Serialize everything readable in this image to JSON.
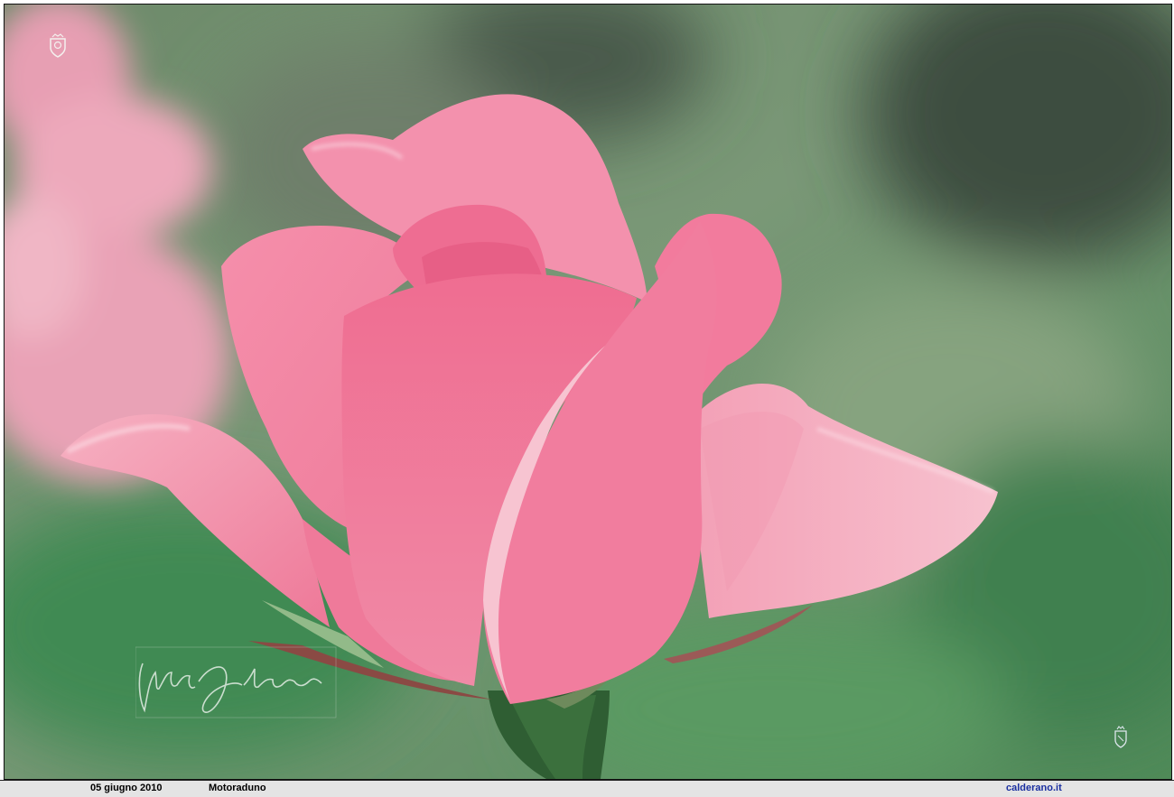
{
  "photo": {
    "subject": "pink-rose-bud",
    "colors": {
      "background_green": "#6f9a6a",
      "background_dark": "#2f4a33",
      "petal_pink": "#f07a9c",
      "petal_light": "#f6b5c5",
      "petal_deep": "#e0587f",
      "stem_green": "#3c6a3b"
    }
  },
  "caption": {
    "date": "05 giugno 2010",
    "event": "Motoraduno",
    "site": "calderano.it"
  },
  "watermark": {
    "signature_icon": "handwritten-signature",
    "logo_top_left_icon": "crest-logo",
    "logo_bottom_right_icon": "crest-logo"
  }
}
